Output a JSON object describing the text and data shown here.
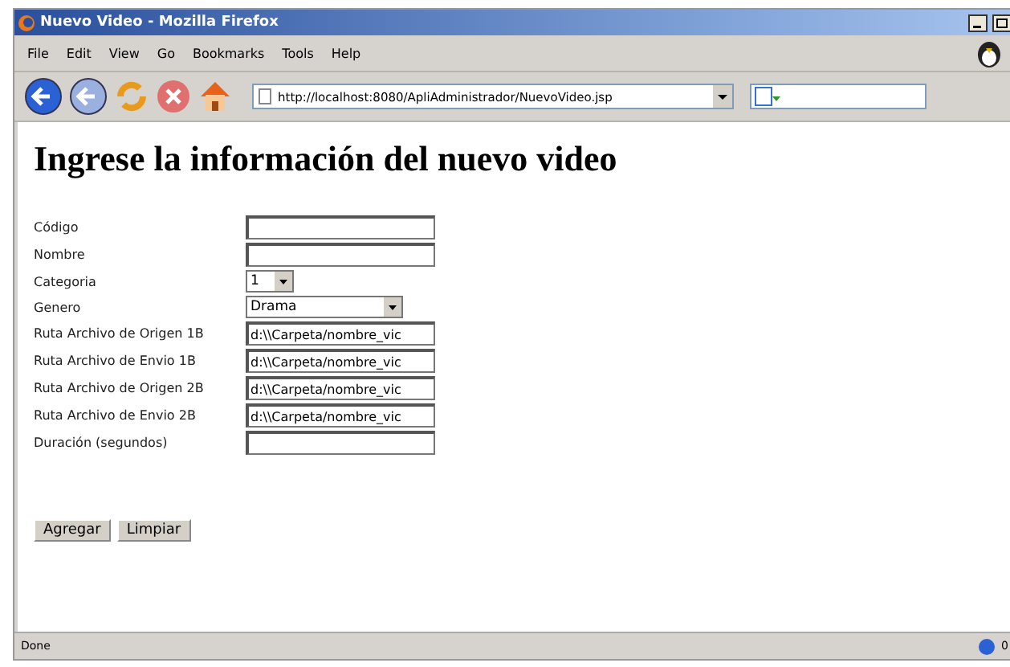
{
  "window": {
    "title": "Nuevo Video - Mozilla Firefox"
  },
  "menu": [
    "File",
    "Edit",
    "View",
    "Go",
    "Bookmarks",
    "Tools",
    "Help"
  ],
  "address": {
    "url": "http://localhost:8080/ApliAdministrador/NuevoVideo.jsp"
  },
  "page": {
    "heading": "Ingrese la información del nuevo video",
    "fields": [
      {
        "label": "Código",
        "kind": "text"
      },
      {
        "label": "Nombre",
        "kind": "text"
      },
      {
        "label": "Categoria",
        "kind": "select",
        "value": "1"
      },
      {
        "label": "Genero",
        "kind": "select",
        "value": "Drama"
      },
      {
        "label": "Ruta Archivo de Origen 1B",
        "kind": "text",
        "value": "d:\\\\Carpeta/nombre_vic"
      },
      {
        "label": "Ruta Archivo de Envio 1B",
        "kind": "text",
        "value": "d:\\\\Carpeta/nombre_vic"
      },
      {
        "label": "Ruta Archivo de Origen 2B",
        "kind": "text",
        "value": "d:\\\\Carpeta/nombre_vic"
      },
      {
        "label": "Ruta Archivo de Envio 2B",
        "kind": "text",
        "value": "d:\\\\Carpeta/nombre_vic"
      },
      {
        "label": "Duración (segundos)",
        "kind": "text"
      }
    ],
    "buttons": [
      "Agregar",
      "Limpiar"
    ]
  },
  "status_bar": {
    "text": "Done",
    "count": "0"
  }
}
